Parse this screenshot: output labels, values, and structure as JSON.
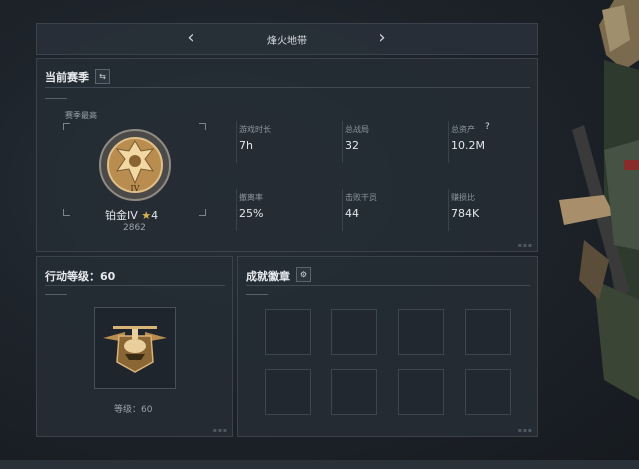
{
  "nav": {
    "title": "烽火地带",
    "prev_icon": "chevron-left",
    "next_icon": "chevron-right"
  },
  "season": {
    "title": "当前赛季",
    "switch_icon": "swap-icon",
    "badge_caption": "赛季最高",
    "rank": "铂金IV",
    "rank_stars": "4",
    "score": "2862",
    "stats": [
      {
        "label": "游戏时长",
        "value": "7h"
      },
      {
        "label": "总战局",
        "value": "32"
      },
      {
        "label": "总资产",
        "value": "10.2M",
        "help": "?"
      },
      {
        "label": "撤离率",
        "value": "25%"
      },
      {
        "label": "击败干员",
        "value": "44"
      },
      {
        "label": "赚损比",
        "value": "784K"
      }
    ]
  },
  "level": {
    "title": "行动等级：60",
    "caption": "等级：60"
  },
  "achievements": {
    "title": "成就徽章",
    "settings_icon": "gear-icon",
    "slots": 8
  },
  "colors": {
    "gold": "#b98d4f",
    "panel": "#252c34",
    "accent_text": "#e3e7eb"
  }
}
